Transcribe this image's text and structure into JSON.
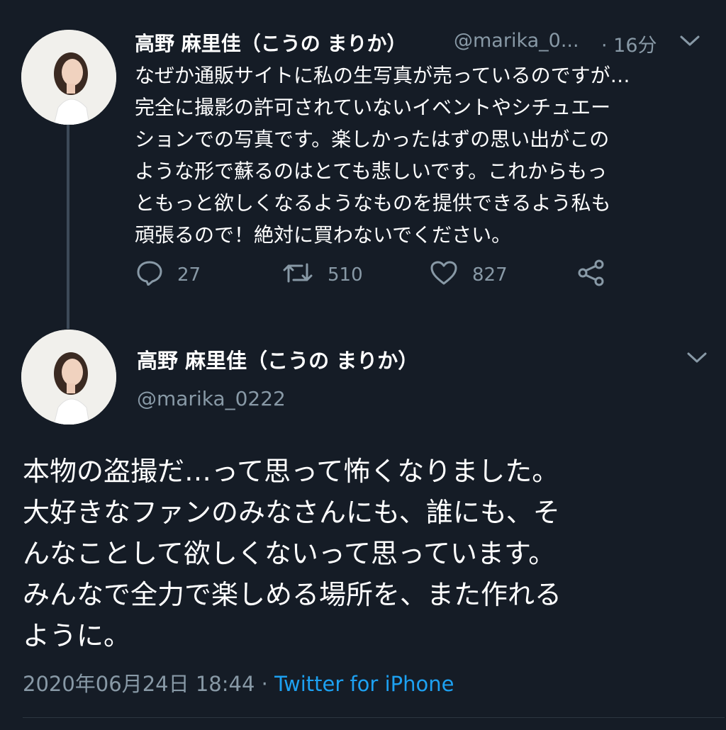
{
  "tweet1": {
    "display_name": "高野 麻里佳（こうの まりか）",
    "handle": "@marika_0...",
    "time": "· 16分",
    "text_lines": [
      "なぜか通販サイトに私の生写真が売っているのですが…",
      "完全に撮影の許可されていないイベントやシチュエー",
      "ションでの写真です。楽しかったはずの思い出がこの",
      "ような形で蘇るのはとても悲しいです。これからもっ",
      "ともっと欲しくなるようなものを提供できるよう私も",
      "頑張るので！絶対に買わないでください。"
    ],
    "replies": "27",
    "retweets": "510",
    "likes": "827"
  },
  "tweet2": {
    "display_name": "高野 麻里佳（こうの まりか）",
    "handle": "@marika_0222",
    "text_lines": [
      "本物の盗撮だ…って思って怖くなりました。",
      "大好きなファンのみなさんにも、誰にも、そ",
      "んなことして欲しくないって思っています。",
      "みんなで全力で楽しめる場所を、また作れる",
      "ように。"
    ],
    "date": "2020年06月24日 18:44 · ",
    "source": "Twitter for iPhone"
  },
  "colors": {
    "background": "#151c26",
    "muted": "#8899a6",
    "accent": "#1da1f2"
  },
  "icons": [
    "reply-icon",
    "retweet-icon",
    "like-icon",
    "share-icon",
    "chevron-down-icon"
  ]
}
